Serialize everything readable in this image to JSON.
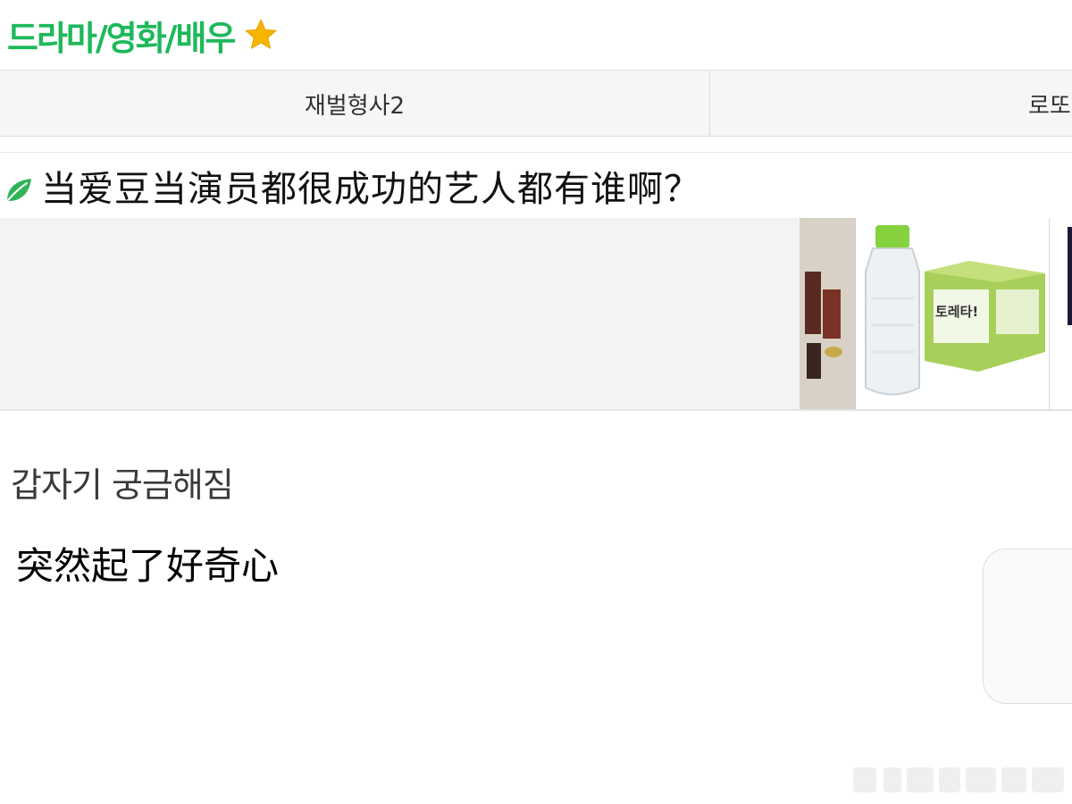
{
  "category": {
    "title": "드라마/영화/배우",
    "icon": "star-icon",
    "accent_color": "#1db85a"
  },
  "tabs": [
    {
      "label": "재벌형사2"
    },
    {
      "label": "로또"
    }
  ],
  "post": {
    "title_icon": "leaf-icon",
    "title": "当爱豆当演员都很成功的艺人都有谁啊？",
    "body_korean": "갑자기 궁금해짐",
    "body_translation": "突然起了好奇心"
  },
  "ad": {
    "product_label": "토레타!"
  }
}
